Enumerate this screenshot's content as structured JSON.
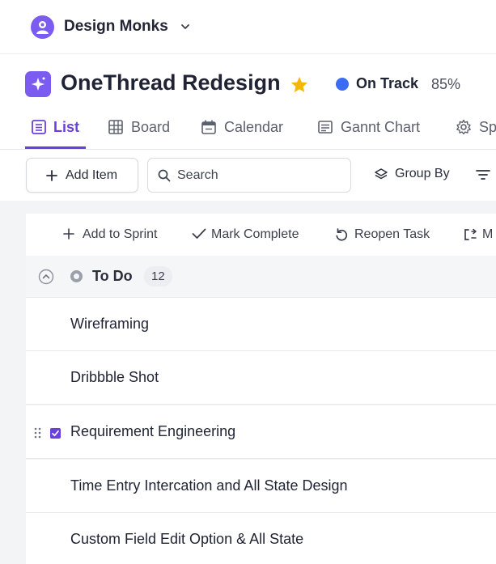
{
  "workspace": {
    "name": "Design Monks",
    "logo_icon": "workspace-logo-icon",
    "dropdown_icon": "chevron-down-icon"
  },
  "project": {
    "title": "OneThread Redesign",
    "icon": "project-sparkle-icon",
    "favorite_icon": "star-icon",
    "status_label": "On Track",
    "status_percent": "85%",
    "status_color": "#3d6cf4",
    "accent": "#6a3fe0",
    "star_color": "#f5b800"
  },
  "tabs": [
    {
      "label": "List",
      "icon": "list-icon",
      "active": true
    },
    {
      "label": "Board",
      "icon": "grid-icon",
      "active": false
    },
    {
      "label": "Calendar",
      "icon": "calendar-icon",
      "active": false
    },
    {
      "label": "Gannt Chart",
      "icon": "gantt-icon",
      "active": false
    },
    {
      "label": "Sp",
      "icon": "gear-icon",
      "active": false
    }
  ],
  "toolbar": {
    "add_label": "Add Item",
    "search_placeholder": "Search",
    "group_by_label": "Group By"
  },
  "bulk_actions": [
    {
      "label": "Add to Sprint",
      "icon": "plus-icon"
    },
    {
      "label": "Mark Complete",
      "icon": "check-icon"
    },
    {
      "label": "Reopen Task",
      "icon": "reopen-icon"
    },
    {
      "label": "M",
      "icon": "move-icon"
    }
  ],
  "group": {
    "label": "To Do",
    "count": "12"
  },
  "tasks": [
    {
      "name": "Wireframing",
      "selected": false
    },
    {
      "name": "Dribbble Shot",
      "selected": false
    },
    {
      "name": "Requirement Engineering",
      "selected": true
    },
    {
      "name": "Time Entry Intercation and All State Design",
      "selected": false
    },
    {
      "name": "Custom Field Edit Option & All State",
      "selected": false
    }
  ]
}
